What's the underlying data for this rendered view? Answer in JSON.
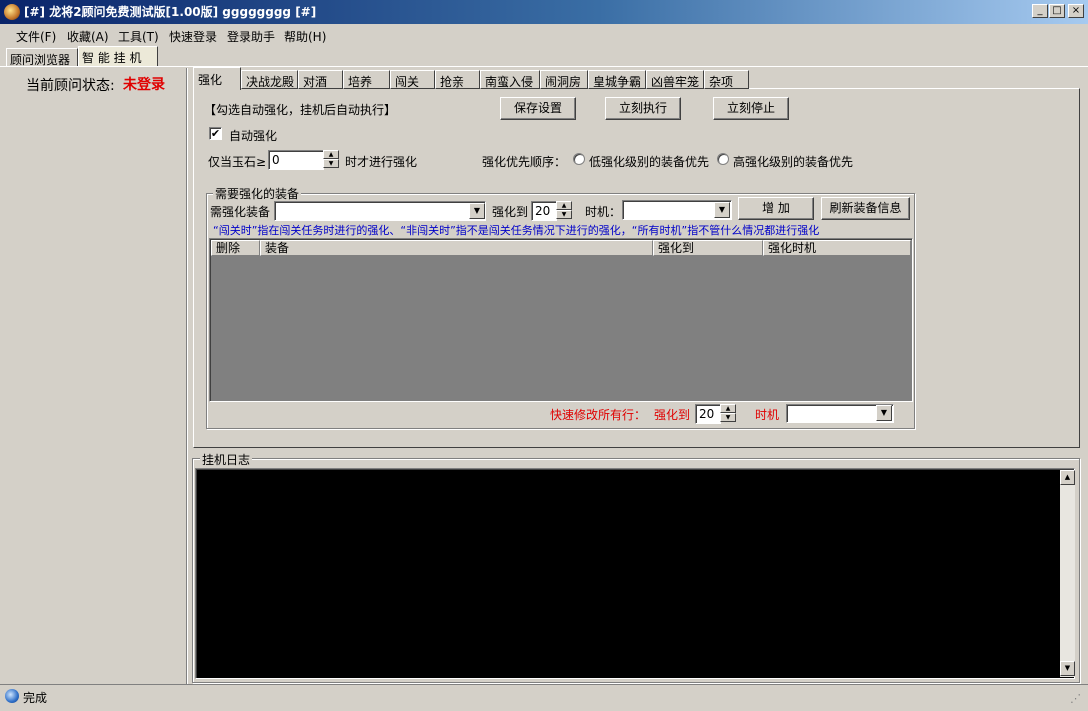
{
  "window": {
    "title": "[#] 龙将2顾问免费测试版[1.00版] gggggggg [#]",
    "controls": {
      "minimize": "_",
      "maximize": "□",
      "close": "×"
    }
  },
  "menu": [
    "文件(F)",
    "收藏(A)",
    "工具(T)",
    "快速登录",
    "登录助手",
    "帮助(H)"
  ],
  "top_tabs": [
    "顾问浏览器",
    "智 能 挂 机"
  ],
  "status": {
    "label": "当前顾问状态:",
    "value": "未登录"
  },
  "inner_tabs": [
    "强化",
    "决战龙殿",
    "对酒",
    "培养",
    "闯关",
    "抢亲",
    "南蛮入侵",
    "闹洞房",
    "皇城争霸",
    "凶兽牢笼",
    "杂项"
  ],
  "strengthen": {
    "hint": "【勾选自动强化，挂机后自动执行】",
    "buttons": {
      "save": "保存设置",
      "execute": "立刻执行",
      "stop": "立刻停止"
    },
    "auto_checkbox": {
      "label": "自动强化",
      "checked": true,
      "mark": "✔"
    },
    "jade": {
      "label_before": "仅当玉石≥",
      "value": "0",
      "label_after": "时才进行强化"
    },
    "priority": {
      "label": "强化优先顺序：",
      "options": [
        "低强化级别的装备优先",
        "高强化级别的装备优先"
      ]
    },
    "group": {
      "title": "需要强化的装备",
      "equip_label": "需强化装备",
      "equip_value": "",
      "to_label": "强化到",
      "to_value": "20",
      "timing_label": "时机：",
      "timing_value": "",
      "add_button": "增 加",
      "refresh_button": "刷新装备信息",
      "note": "“闯关时”指在闯关任务时进行的强化、“非闯关时”指不是闯关任务情况下进行的强化，“所有时机”指不管什么情况都进行强化",
      "columns": [
        "删除",
        "装备",
        "强化到",
        "强化时机"
      ],
      "quick_edit": {
        "label": "快速修改所有行：",
        "to_label": "强化到",
        "to_value": "20",
        "timing_label": "时机",
        "timing_value": ""
      }
    }
  },
  "log": {
    "title": "挂机日志",
    "content": ""
  },
  "statusbar": {
    "text": "完成"
  }
}
